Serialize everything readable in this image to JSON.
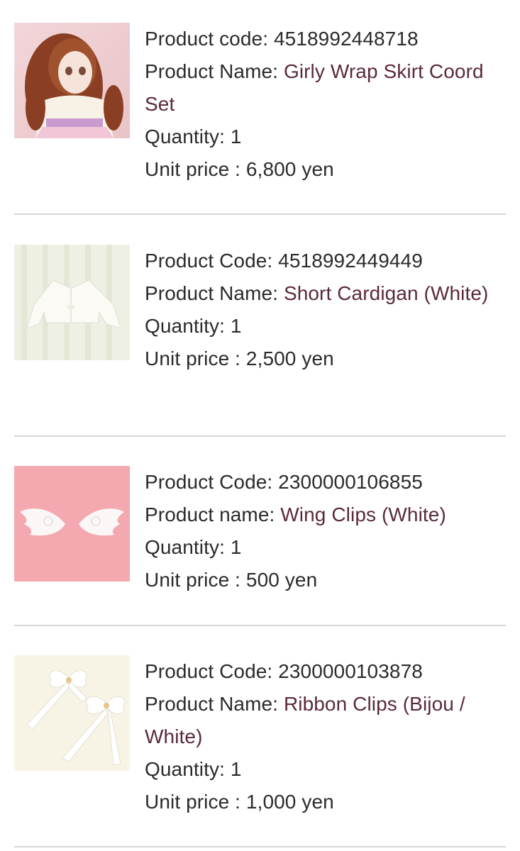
{
  "items": [
    {
      "code_label": "Product code: ",
      "code": "4518992448718",
      "name_label": "Product Name: ",
      "name": "Girly Wrap Skirt Coord Set",
      "qty_label": "Quantity: ",
      "qty": "1",
      "price_label": "Unit price : ",
      "price": "6,800 yen",
      "image_icon": "doll-outfit-photo"
    },
    {
      "code_label": "Product Code: ",
      "code": "4518992449449",
      "name_label": "Product Name: ",
      "name": "Short Cardigan (White)",
      "qty_label": "Quantity: ",
      "qty": "1",
      "price_label": "Unit price : ",
      "price": "2,500 yen",
      "image_icon": "cardigan-photo"
    },
    {
      "code_label": "Product Code: ",
      "code": "2300000106855",
      "name_label": "Product name: ",
      "name": "Wing Clips (White)",
      "qty_label": "Quantity: ",
      "qty": "1",
      "price_label": "Unit price : ",
      "price": "500 yen",
      "image_icon": "wing-clips-photo"
    },
    {
      "code_label": "Product Code: ",
      "code": "2300000103878",
      "name_label": "Product Name: ",
      "name": "Ribbon Clips (Bijou / White)",
      "qty_label": "Quantity: ",
      "qty": "1",
      "price_label": "Unit price : ",
      "price": "1,000 yen",
      "image_icon": "ribbon-clips-photo"
    }
  ],
  "colors": {
    "text": "#2b2b2b",
    "product_name_link": "#5a2a3c",
    "divider": "#d6d6d6"
  }
}
